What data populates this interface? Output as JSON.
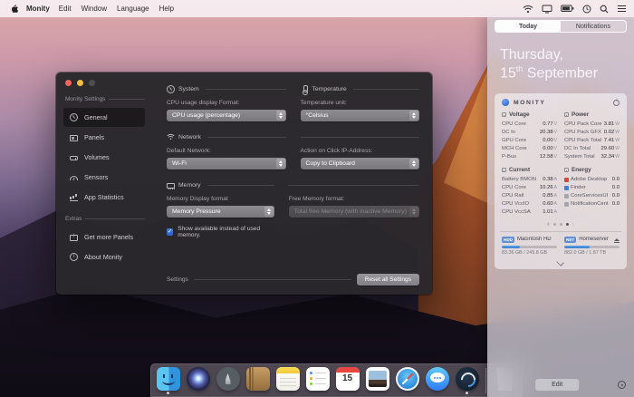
{
  "menu_bar": {
    "app_menu": "Monity",
    "items": [
      "Edit",
      "Window",
      "Language",
      "Help"
    ],
    "status_icons": [
      "wifi-icon",
      "display-icon",
      "battery-icon",
      "clock-icon",
      "search-icon",
      "notification-center-icon"
    ]
  },
  "settings_window": {
    "sidebar": {
      "header": "Monity Settings",
      "items": [
        {
          "label": "General",
          "icon": "gauge",
          "selected": true
        },
        {
          "label": "Panels",
          "icon": "panels",
          "selected": false
        },
        {
          "label": "Volumes",
          "icon": "drive",
          "selected": false
        },
        {
          "label": "Sensors",
          "icon": "sensor",
          "selected": false
        },
        {
          "label": "App Statistics",
          "icon": "chart",
          "selected": false
        }
      ],
      "extras_header": "Extras",
      "extras_items": [
        {
          "label": "Get more Panels",
          "icon": "panels-plus"
        },
        {
          "label": "About Monity",
          "icon": "info"
        }
      ]
    },
    "system": {
      "title": "System",
      "field_label": "CPU usage display Format:",
      "dropdown_value": "CPU usage (percentage)"
    },
    "temperature": {
      "title": "Temperature",
      "field_label": "Temperature unit:",
      "dropdown_value": "°Celsius"
    },
    "network": {
      "title": "Network",
      "field_label": "Default Network:",
      "dropdown_value": "Wi-Fi"
    },
    "ip_action": {
      "field_label": "Action on Click IP-Address:",
      "dropdown_value": "Copy to Clipboard"
    },
    "memory": {
      "title": "Memory",
      "field_label": "Memory Display format",
      "dropdown_value": "Memory Pressure",
      "free_field_label": "Free Memory format:",
      "free_dropdown_value": "Total free Memory (with inactive Memory)",
      "checkbox_checked": true,
      "checkbox_glyph": "✓",
      "checkbox_label": "Show available instead of used memory."
    },
    "footer": {
      "title": "Settings",
      "reset_button": "Reset all Settings"
    }
  },
  "notification_center": {
    "tabs": [
      {
        "label": "Today",
        "active": true
      },
      {
        "label": "Notifications",
        "active": false
      }
    ],
    "date_line1": "Thursday,",
    "date_day": "15",
    "date_day_suffix": "th",
    "date_month": " September",
    "widget": {
      "title": "MONITY",
      "groups": {
        "voltage": {
          "title": "Voltage",
          "rows": [
            [
              "CPU Core",
              "0.77",
              "V"
            ],
            [
              "DC In",
              "20.38",
              "V"
            ],
            [
              "GPU Core",
              "0.00",
              "V"
            ],
            [
              "MCH Core",
              "0.00",
              "V"
            ],
            [
              "P-Bus",
              "12.58",
              "V"
            ]
          ]
        },
        "power": {
          "title": "Power",
          "rows": [
            [
              "CPU Pack Core",
              "3.81",
              "W"
            ],
            [
              "CPU Pack GFX",
              "0.02",
              "W"
            ],
            [
              "CPU Pack Total",
              "7.41",
              "W"
            ],
            [
              "DC In Total",
              "29.60",
              "W"
            ],
            [
              "System Total",
              "32.34",
              "W"
            ]
          ]
        },
        "current": {
          "title": "Current",
          "rows": [
            [
              "Battery BMON",
              "0.38",
              "A"
            ],
            [
              "CPU Core",
              "10.26",
              "A"
            ],
            [
              "CPU Rail",
              "0.85",
              "A"
            ],
            [
              "CPU VccIO",
              "0.60",
              "A"
            ],
            [
              "CPU VccSA",
              "1.01",
              "A"
            ]
          ]
        },
        "energy": {
          "title": "Energy",
          "rows": [
            {
              "name": "Adobe Desktop",
              "value": "0.0",
              "color": "#e0443a"
            },
            {
              "name": "Finder",
              "value": "0.0",
              "color": "#3b82e0"
            },
            {
              "name": "CoreServicesUI",
              "value": "0.0",
              "color": "#a5a5ad"
            },
            {
              "name": "NotificationCent",
              "value": "0.0",
              "color": "#a5a5ad"
            }
          ]
        }
      },
      "page_dots": [
        {
          "on": false
        },
        {
          "on": false
        },
        {
          "on": true
        }
      ],
      "disks": [
        {
          "badge": "HDD",
          "name": "Macintosh HD",
          "usage": "83.36 GB / 249.8 GB",
          "pct": 33,
          "eject": false
        },
        {
          "badge": "NET",
          "name": "Homeserver",
          "usage": "882.0 GB / 1.87 TB",
          "pct": 46,
          "eject": true
        }
      ]
    },
    "edit_button": "Edit"
  },
  "dock": {
    "icons": [
      {
        "name": "finder",
        "icon_name": "finder-icon",
        "running": true
      },
      {
        "name": "siri",
        "icon_name": "siri-icon"
      },
      {
        "name": "launchpad",
        "icon_name": "launchpad-icon"
      },
      {
        "name": "contacts",
        "icon_name": "contacts-icon"
      },
      {
        "name": "notes",
        "icon_name": "notes-icon"
      },
      {
        "name": "reminders",
        "icon_name": "reminders-icon"
      },
      {
        "name": "calendar",
        "icon_name": "calendar-icon",
        "day": "15"
      },
      {
        "name": "preview",
        "icon_name": "preview-icon"
      },
      {
        "name": "safari",
        "icon_name": "safari-icon"
      },
      {
        "name": "messages",
        "icon_name": "messages-icon"
      },
      {
        "name": "monity",
        "icon_name": "monity-dock-icon",
        "running": true
      },
      {
        "name": "trash",
        "icon_name": "trash-icon",
        "separator_before": true
      }
    ]
  }
}
